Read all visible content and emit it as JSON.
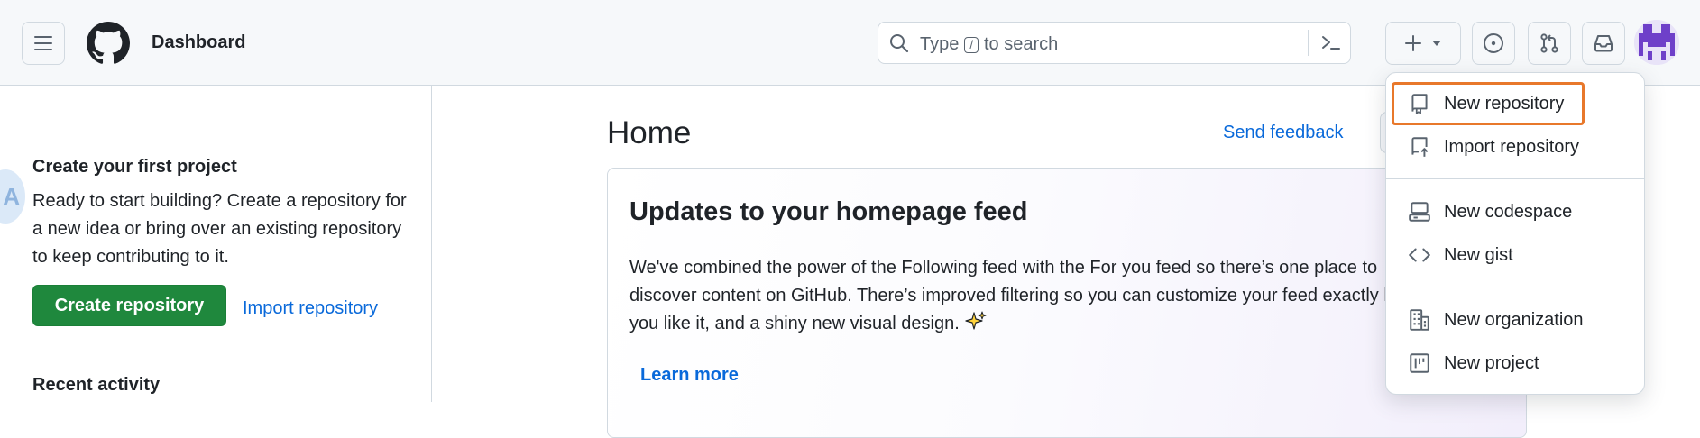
{
  "header": {
    "title": "Dashboard",
    "search": {
      "placeholder_before": "Type",
      "shortcut_key": "/",
      "placeholder_after": "to search"
    },
    "icons": {
      "menu": "hamburger-menu-icon",
      "logo": "github-logo-icon",
      "search": "search-icon",
      "command": "command-palette-icon",
      "new": "plus-icon",
      "issues": "issue-opened-icon",
      "pulls": "git-pull-request-icon",
      "inbox": "inbox-icon"
    }
  },
  "sidebar": {
    "project_title": "Create your first project",
    "project_description": "Ready to start building? Create a repository for a new idea or bring over an existing repository to keep contributing to it.",
    "create_button": "Create repository",
    "import_link": "Import repository",
    "recent_title": "Recent activity"
  },
  "main": {
    "title": "Home",
    "feedback_link": "Send feedback",
    "card": {
      "title": "Updates to your homepage feed",
      "body": "We've combined the power of the Following feed with the For you feed so there’s one place to discover content on GitHub. There’s improved filtering so you can customize your feed exactly how you like it, and a shiny new visual design.",
      "learn_more": "Learn more"
    }
  },
  "dropdown": {
    "items": [
      {
        "label": "New repository",
        "icon": "repo-icon"
      },
      {
        "label": "Import repository",
        "icon": "repo-push-icon"
      },
      {
        "label": "New codespace",
        "icon": "codespaces-icon"
      },
      {
        "label": "New gist",
        "icon": "code-icon"
      },
      {
        "label": "New organization",
        "icon": "organization-icon"
      },
      {
        "label": "New project",
        "icon": "project-icon"
      }
    ]
  },
  "colors": {
    "accent": "#0969da",
    "primary_button": "#1f883d",
    "focus_ring": "#e8782b",
    "avatar": "#6e40c9"
  }
}
